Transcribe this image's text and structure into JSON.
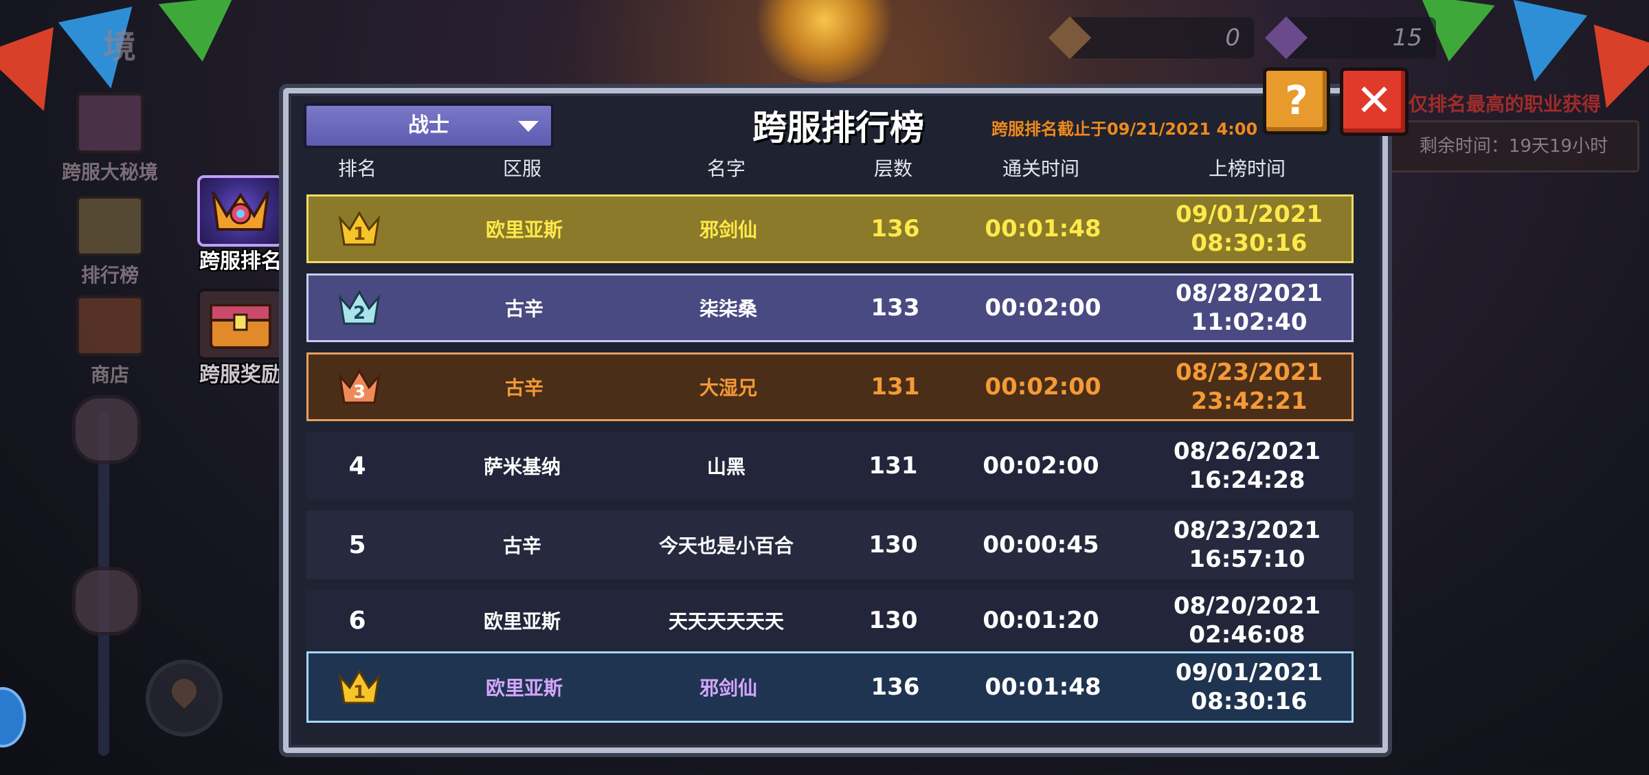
{
  "background": {
    "left_title": "境",
    "nav": [
      {
        "label": "跨服大秘境",
        "icon": "trophy-purple-icon"
      },
      {
        "label": "排行榜",
        "icon": "trophy-icon"
      },
      {
        "label": "商店",
        "icon": "shop-icon"
      }
    ],
    "hud": [
      {
        "value": "0",
        "icon": "orange-gem-icon"
      },
      {
        "value": "15",
        "icon": "purple-gem-icon"
      }
    ],
    "red_tip": "仅排名最高的职业获得",
    "remaining_time": "剩余时间：19天19小时"
  },
  "side_tabs": [
    {
      "label": "跨服排名",
      "icon": "ranking-emblem-icon",
      "active": true
    },
    {
      "label": "跨服奖励",
      "icon": "treasure-chest-icon",
      "active": false
    }
  ],
  "panel": {
    "dropdown_value": "战士",
    "title": "跨服排行榜",
    "deadline": "跨服排名截止于09/21/2021 4:00",
    "help_label": "?",
    "close_label": "✕"
  },
  "columns": [
    "排名",
    "区服",
    "名字",
    "层数",
    "通关时间",
    "上榜时间"
  ],
  "rows": [
    {
      "rank": "1",
      "server": "欧里亚斯",
      "name": "邪剑仙",
      "floor": "136",
      "clear_time": "00:01:48",
      "date": "09/01/2021",
      "time": "08:30:16",
      "style": "gold"
    },
    {
      "rank": "2",
      "server": "古辛",
      "name": "柒柒桑",
      "floor": "133",
      "clear_time": "00:02:00",
      "date": "08/28/2021",
      "time": "11:02:40",
      "style": "silver"
    },
    {
      "rank": "3",
      "server": "古辛",
      "name": "大湿兄",
      "floor": "131",
      "clear_time": "00:02:00",
      "date": "08/23/2021",
      "time": "23:42:21",
      "style": "bronze"
    },
    {
      "rank": "4",
      "server": "萨米基纳",
      "name": "山黑",
      "floor": "131",
      "clear_time": "00:02:00",
      "date": "08/26/2021",
      "time": "16:24:28",
      "style": "plain"
    },
    {
      "rank": "5",
      "server": "古辛",
      "name": "今天也是小百合",
      "floor": "130",
      "clear_time": "00:00:45",
      "date": "08/23/2021",
      "time": "16:57:10",
      "style": "plain"
    },
    {
      "rank": "6",
      "server": "欧里亚斯",
      "name": "天天天天天天",
      "floor": "130",
      "clear_time": "00:01:20",
      "date": "08/20/2021",
      "time": "02:46:08",
      "style": "plain"
    }
  ],
  "self_row": {
    "rank": "1",
    "server": "欧里亚斯",
    "name": "邪剑仙",
    "floor": "136",
    "clear_time": "00:01:48",
    "date": "09/01/2021",
    "time": "08:30:16"
  },
  "colors": {
    "gold": "#ffe94a",
    "bronze": "#f59a36",
    "deadline": "#f08a1c",
    "self_name": "#d5a6ff"
  }
}
